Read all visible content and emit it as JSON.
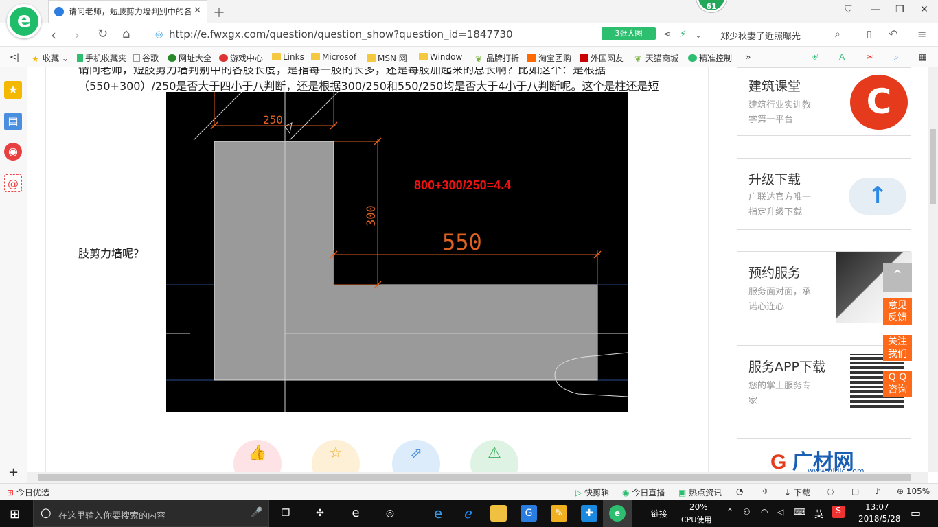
{
  "tab": {
    "title": "请问老师，短肢剪力墙判别中的各"
  },
  "badge": {
    "count": "61"
  },
  "address": {
    "url": "http://e.fwxgx.com/question/question_show?question_id=1847730",
    "big_image_label": "3张大图",
    "search_hint": "郑少秋妻子近照曝光"
  },
  "bookmarks": [
    {
      "label": "收藏"
    },
    {
      "label": "手机收藏夹"
    },
    {
      "label": "谷歌"
    },
    {
      "label": "网址大全"
    },
    {
      "label": "游戏中心"
    },
    {
      "label": "Links"
    },
    {
      "label": "Microsof"
    },
    {
      "label": "MSN 网"
    },
    {
      "label": "Window"
    },
    {
      "label": "品牌打折"
    },
    {
      "label": "淘宝团购"
    },
    {
      "label": "外国网友"
    },
    {
      "label": "天猫商城"
    },
    {
      "label": "精准控制"
    }
  ],
  "question": {
    "line1": "请问老师，短肢剪力墙判别中的各肢长度，是指每一肢的长多，还是每肢加起来的总长啊？比如这个：是根据",
    "line2": "（550+300）/250是否大于四小于八判断，还是根据300/250和550/250均是否大于4小于八判断呢。这个是柱还是短",
    "line3": "肢剪力墙呢？"
  },
  "cad": {
    "dim_top": "250",
    "dim_vertical": "300",
    "dim_horizontal": "550",
    "formula": "800+300/250=4.4"
  },
  "cards": [
    {
      "title": "建筑课堂",
      "sub1": "建筑行业实训教",
      "sub2": "学第一平台"
    },
    {
      "title": "升级下载",
      "sub1": "广联达官方唯一",
      "sub2": "指定升级下载"
    },
    {
      "title": "预约服务",
      "sub1": "服务面对面，承",
      "sub2": "诺心连心"
    },
    {
      "title": "服务APP下载",
      "sub1": "您的掌上服务专",
      "sub2": "家"
    },
    {
      "title": "广材网",
      "sub1": "www.gldjc.com"
    }
  ],
  "float": {
    "feedback": [
      "意见",
      "反馈"
    ],
    "follow": [
      "关注",
      "我们"
    ],
    "qq": [
      "Q Q",
      "咨询"
    ]
  },
  "status": {
    "today": "今日优选",
    "kuaijianji": "快剪辑",
    "live": "今日直播",
    "news": "热点资讯",
    "download": "下载",
    "zoom": "105%"
  },
  "taskbar": {
    "search_placeholder": "在这里输入你要搜索的内容",
    "links": "链接",
    "cpu": "20%",
    "cpu_label": "CPU使用",
    "ime": "英",
    "time": "13:07",
    "date": "2018/5/28"
  }
}
